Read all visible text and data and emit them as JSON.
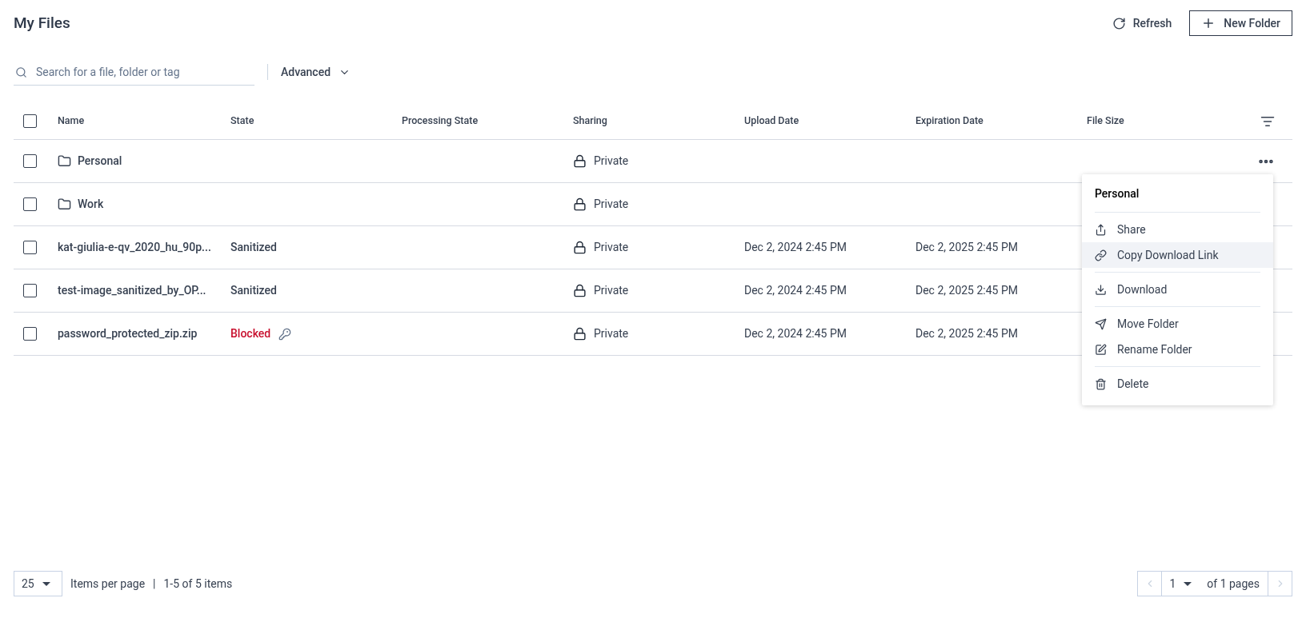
{
  "title": "My Files",
  "actions": {
    "refresh": "Refresh",
    "new_folder": "New Folder"
  },
  "search": {
    "placeholder": "Search for a file, folder or tag"
  },
  "advanced": "Advanced",
  "table": {
    "select_all_checked": false,
    "columns": [
      "Name",
      "State",
      "Processing State",
      "Sharing",
      "Upload Date",
      "Expiration Date",
      "File Size"
    ],
    "rows": [
      {
        "kind": "folder",
        "checked": false,
        "name": "Personal",
        "blocked": false,
        "sharing": "Private",
        "menu_open": true
      },
      {
        "kind": "folder",
        "checked": false,
        "name": "Work",
        "blocked": false,
        "sharing": "Private",
        "menu_open": false
      },
      {
        "kind": "file",
        "checked": false,
        "name": "kat-giulia-e-qv_2020_hu_90p...",
        "state": "Sanitized",
        "blocked": false,
        "sharing": "Private",
        "upload": "Dec 2, 2024 2:45 PM",
        "expiration": "Dec 2, 2025 2:45 PM",
        "menu_open": false
      },
      {
        "kind": "file",
        "checked": false,
        "name": "test-image_sanitized_by_OP...",
        "state": "Sanitized",
        "blocked": false,
        "sharing": "Private",
        "upload": "Dec 2, 2024 2:45 PM",
        "expiration": "Dec 2, 2025 2:45 PM",
        "menu_open": false
      },
      {
        "kind": "file",
        "checked": false,
        "name": "password_protected_zip.zip",
        "state": "Blocked",
        "blocked": true,
        "sharing": "Private",
        "upload": "Dec 2, 2024 2:45 PM",
        "expiration": "Dec 2, 2025 2:45 PM",
        "menu_open": false
      }
    ]
  },
  "menu": {
    "title": "Personal",
    "groups": [
      [
        {
          "kind": "share",
          "label": "Share",
          "selected": false
        },
        {
          "kind": "link",
          "label": "Copy Download Link",
          "selected": true
        }
      ],
      [
        {
          "kind": "download",
          "label": "Download",
          "selected": false
        }
      ],
      [
        {
          "kind": "move",
          "label": "Move Folder",
          "selected": false
        },
        {
          "kind": "rename",
          "label": "Rename Folder",
          "selected": false
        }
      ],
      [
        {
          "kind": "delete",
          "label": "Delete",
          "selected": false
        }
      ]
    ]
  },
  "pagination": {
    "page_size": "25",
    "items_per_page": "Items per page",
    "separator": "|",
    "range": "1-5 of 5 items",
    "page": "1",
    "of_pages": "of 1 pages",
    "prev_disabled": true,
    "next_disabled": true
  }
}
